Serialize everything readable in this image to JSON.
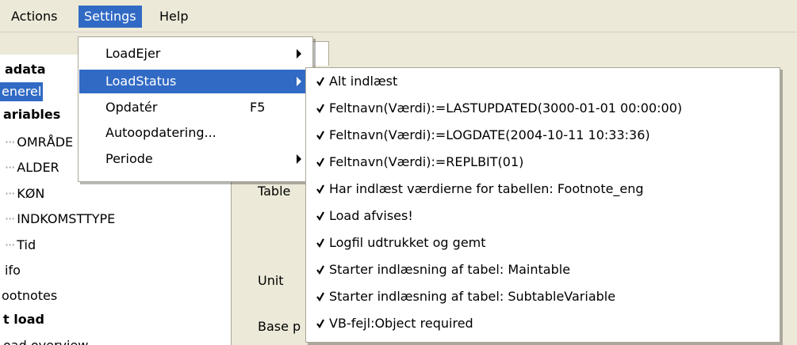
{
  "menubar": {
    "items": [
      {
        "label": "Actions"
      },
      {
        "label": "Settings"
      },
      {
        "label": "Help"
      }
    ]
  },
  "tree": {
    "nodes": [
      {
        "label": "adata"
      },
      {
        "label": "enerel"
      },
      {
        "label": "ariables"
      },
      {
        "label": "OMRÅDE"
      },
      {
        "label": "ALDER"
      },
      {
        "label": "KØN"
      },
      {
        "label": "INDKOMSTTYPE"
      },
      {
        "label": "Tid"
      },
      {
        "label": "ifo"
      },
      {
        "label": "ootnotes"
      },
      {
        "label": "t load"
      },
      {
        "label": "oad overview"
      }
    ]
  },
  "form": {
    "labels": [
      "Table",
      "Unit",
      "Base p"
    ]
  },
  "settings_menu": {
    "items": [
      {
        "label": "LoadEjer",
        "shortcut": ""
      },
      {
        "label": "LoadStatus",
        "shortcut": ""
      },
      {
        "label": "Opdatér",
        "shortcut": "F5"
      },
      {
        "label": "Autoopdatering...",
        "shortcut": ""
      },
      {
        "label": "Periode",
        "shortcut": ""
      }
    ]
  },
  "loadstatus_menu": {
    "items": [
      {
        "label": "Alt indlæst"
      },
      {
        "label": "Feltnavn(Værdi):=LASTUPDATED(3000-01-01 00:00:00)"
      },
      {
        "label": "Feltnavn(Værdi):=LOGDATE(2004-10-11 10:33:36)"
      },
      {
        "label": "Feltnavn(Værdi):=REPLBIT(01)"
      },
      {
        "label": "Har indlæst værdierne for tabellen: Footnote_eng"
      },
      {
        "label": "Load afvises!"
      },
      {
        "label": "Logfil udtrukket og gemt"
      },
      {
        "label": "Starter indlæsning af tabel: Maintable"
      },
      {
        "label": "Starter indlæsning af tabel: SubtableVariable"
      },
      {
        "label": "VB-fejl:Object required"
      }
    ]
  },
  "colors": {
    "highlight": "#316ac5",
    "face": "#ece9d8",
    "menu_bg": "#ffffff"
  }
}
